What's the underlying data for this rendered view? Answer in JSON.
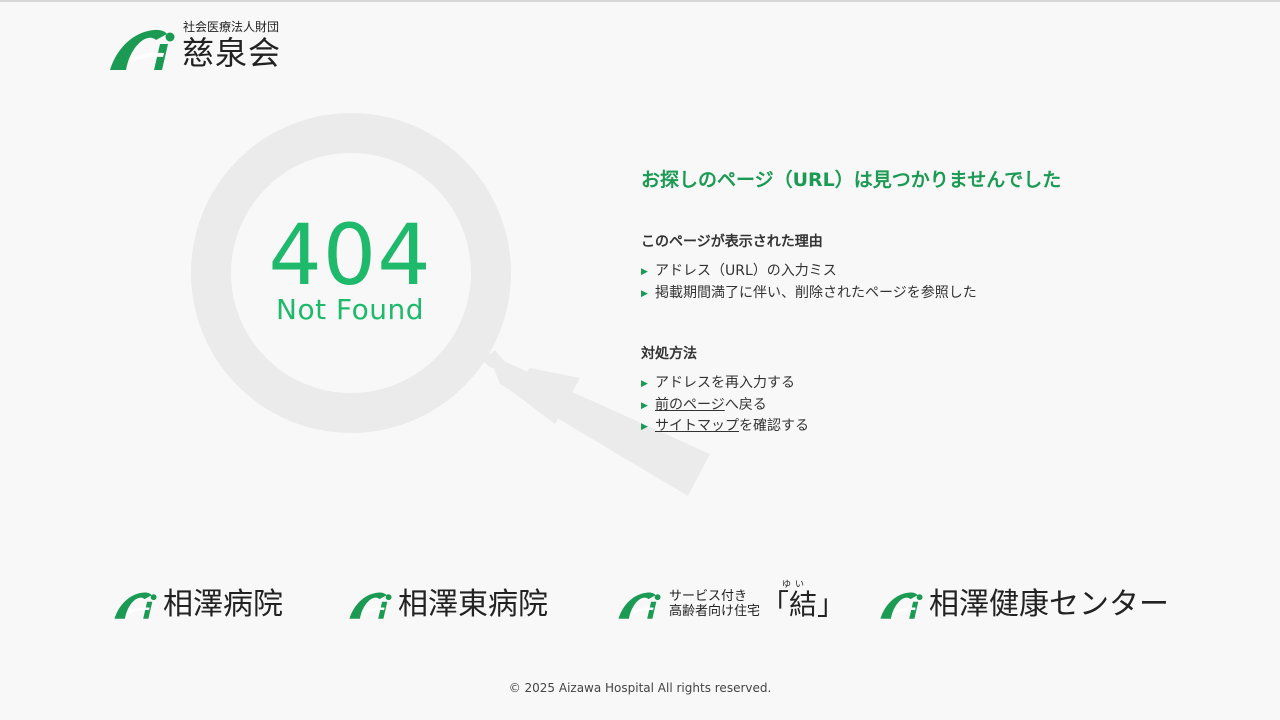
{
  "header": {
    "org_label": "社会医療法人財団",
    "org_name": "慈泉会"
  },
  "error": {
    "code": "404",
    "text": "Not Found"
  },
  "message": {
    "title": "お探しのページ（URL）は見つかりませんでした"
  },
  "reasons": {
    "heading": "このページが表示された理由",
    "items": [
      "アドレス（URL）の入力ミス",
      "掲載期間満了に伴い、削除されたページを参照した"
    ]
  },
  "actions": {
    "heading": "対処方法",
    "item1": "アドレスを再入力する",
    "item2_link": "前のページ",
    "item2_rest": "へ戻る",
    "item3_link": "サイトマップ",
    "item3_rest": "を確認する"
  },
  "facilities": {
    "hospital": "相澤病院",
    "east_hospital": "相澤東病院",
    "residence_sub_line1": "サービス付き",
    "residence_sub_line2": "高齢者向け住宅",
    "residence_name": "「結」",
    "residence_ruby": "ゆい",
    "health_center": "相澤健康センター"
  },
  "footer": {
    "copyright": "© 2025 Aizawa Hospital All rights reserved."
  },
  "colors": {
    "brand_green": "#1a9a52",
    "accent_green": "#1fb96c",
    "magnifier_gray": "#ebebeb",
    "background": "#f8f8f8"
  },
  "icons": {
    "logo": "ai-logo-mark-icon",
    "bullet": "triangle-right-icon",
    "illustration": "magnifier-icon"
  }
}
